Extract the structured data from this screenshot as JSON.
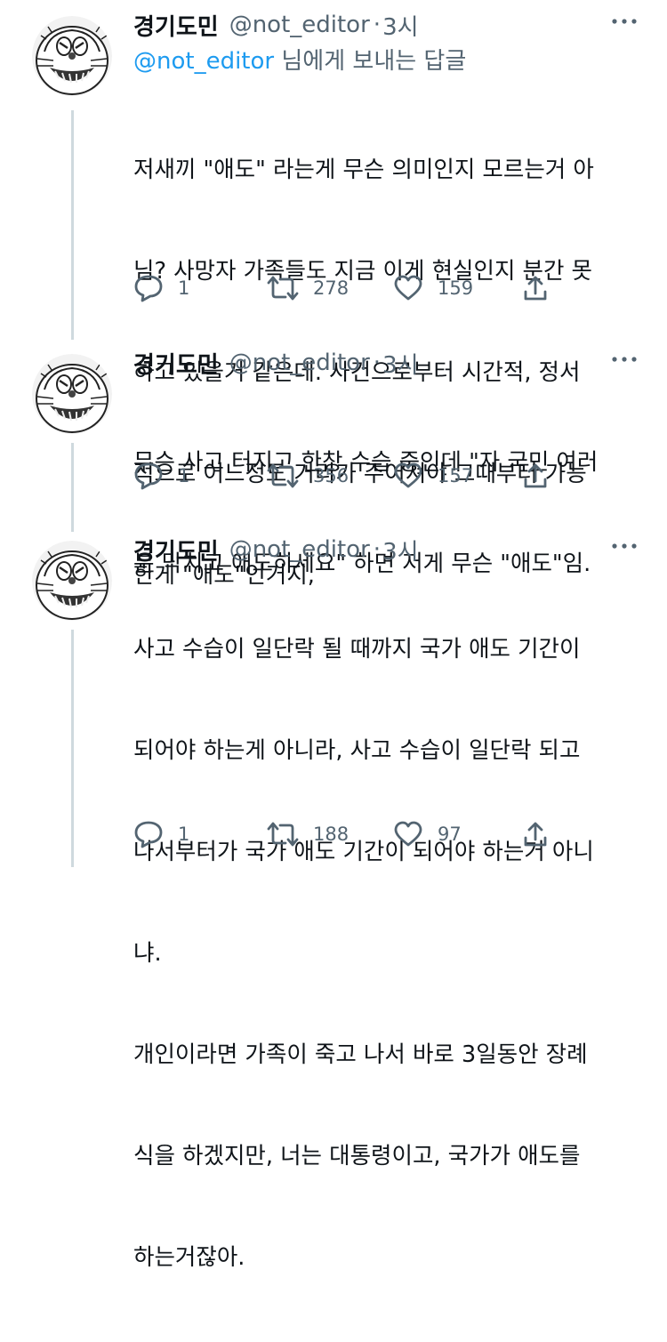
{
  "tweets": [
    {
      "name": "경기도민",
      "handle": "@not_editor",
      "sep": "·",
      "time": "3시",
      "reply_to_mention": "@not_editor",
      "reply_to_suffix": " 님에게 보내는 답글",
      "lines": [
        "저새끼 \"애도\" 라는게 무슨 의미인지 모르는거 아",
        "님? 사망자 가족들도 지금 이게 현실인지 분간 못",
        "하고 있을거 같은데. 사건으로부터 시간적, 정서",
        "적으로 어느정도 거리가 주어져야 그때부터 가능",
        "한게 \"애도\"인거지,"
      ],
      "replies": "1",
      "retweets": "278",
      "likes": "159"
    },
    {
      "name": "경기도민",
      "handle": "@not_editor",
      "sep": "·",
      "time": "3시",
      "lines": [
        "무슨 사고 터지고 한창 수습 중인데 \"자 국민 여러",
        "분 닥치고 애도하세요\" 하면 저게 무슨 \"애도\"임."
      ],
      "replies": "1",
      "retweets": "356",
      "likes": "157"
    },
    {
      "name": "경기도민",
      "handle": "@not_editor",
      "sep": "·",
      "time": "3시",
      "lines": [
        "사고 수습이 일단락 될 때까지 국가 애도 기간이",
        "되어야 하는게 아니라, 사고 수습이 일단락 되고",
        "나서부터가 국가 애도 기간이 되어야 하는거 아니",
        "냐.",
        "개인이라면 가족이 죽고 나서 바로 3일동안 장례",
        "식을 하겠지만, 너는 대통령이고, 국가가 애도를",
        "하는거잖아."
      ],
      "replies": "1",
      "retweets": "188",
      "likes": "97"
    }
  ],
  "colors": {
    "text": "#0f1419",
    "secondary": "#536471",
    "link": "#1d9bf0",
    "thread_line": "#cfd9de"
  },
  "icons": [
    "more-icon",
    "reply-icon",
    "retweet-icon",
    "like-icon",
    "share-icon",
    "avatar-doraemon"
  ]
}
